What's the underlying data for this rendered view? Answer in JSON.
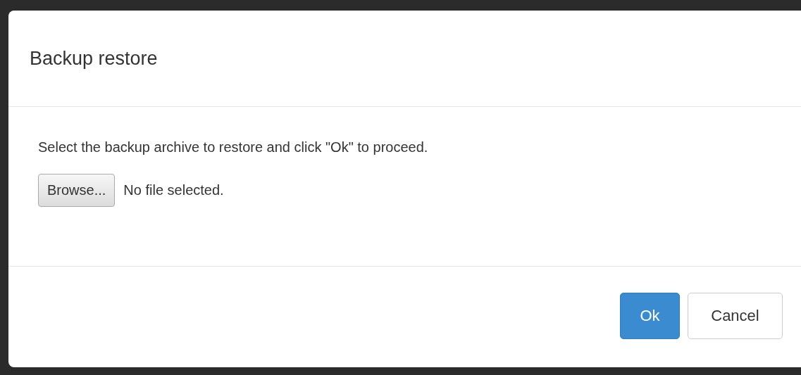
{
  "dialog": {
    "title": "Backup restore",
    "message": "Select the backup archive to restore and click \"Ok\" to proceed.",
    "file_input": {
      "button": "Browse...",
      "status": "No file selected."
    },
    "buttons": [
      {
        "label": "Ok",
        "kind": "primary"
      },
      {
        "label": "Cancel",
        "kind": "default"
      }
    ]
  }
}
